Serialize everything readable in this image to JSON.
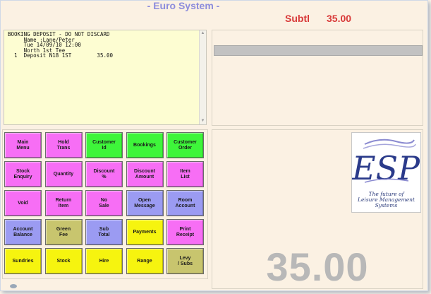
{
  "header": {
    "title": "- Euro System -",
    "subtotal_label": "Subtl",
    "subtotal_value": "35.00"
  },
  "receipt": {
    "lines": "BOOKING DEPOSIT - DO NOT DISCARD\n     Name :Lane/Peter\n     Tue 14/09/10 12:00\n     North 1st Tee\n  1  Deposit N18 1ST        35.00"
  },
  "keys": [
    {
      "label": "Main\nMenu",
      "color": "#f76ef5"
    },
    {
      "label": "Hold\nTrans",
      "color": "#f76ef5"
    },
    {
      "label": "Customer\nId",
      "color": "#3ef53a"
    },
    {
      "label": "Bookings",
      "color": "#3ef53a"
    },
    {
      "label": "Customer\nOrder",
      "color": "#3ef53a"
    },
    {
      "label": "Stock\nEnquiry",
      "color": "#f76ef5"
    },
    {
      "label": "Quantity",
      "color": "#f76ef5"
    },
    {
      "label": "Discount\n%",
      "color": "#f76ef5"
    },
    {
      "label": "Discount\nAmount",
      "color": "#f76ef5"
    },
    {
      "label": "Item\nList",
      "color": "#f76ef5"
    },
    {
      "label": "Void",
      "color": "#f76ef5"
    },
    {
      "label": "Return\nItem",
      "color": "#f76ef5"
    },
    {
      "label": "No\nSale",
      "color": "#f76ef5"
    },
    {
      "label": "Open\nMessage",
      "color": "#9b9bf2"
    },
    {
      "label": "Room\nAccount",
      "color": "#9b9bf2"
    },
    {
      "label": "Account\nBalance",
      "color": "#9b9bf2"
    },
    {
      "label": "Green\nFee",
      "color": "#c8c56e"
    },
    {
      "label": "Sub\nTotal",
      "color": "#9b9bf2"
    },
    {
      "label": "Payments",
      "color": "#f6f40f"
    },
    {
      "label": "Print\nReceipt",
      "color": "#f76ef5"
    },
    {
      "label": "Sundries",
      "color": "#f6f40f"
    },
    {
      "label": "Stock",
      "color": "#f6f40f"
    },
    {
      "label": "Hire",
      "color": "#f6f40f"
    },
    {
      "label": "Range",
      "color": "#f6f40f"
    },
    {
      "label": "Levy\n/ Subs",
      "color": "#c8c56e"
    }
  ],
  "logo": {
    "letters": "ESP",
    "tagline": "The future of\nLeisure Management\nSystems"
  },
  "display": {
    "total": "35.00"
  }
}
